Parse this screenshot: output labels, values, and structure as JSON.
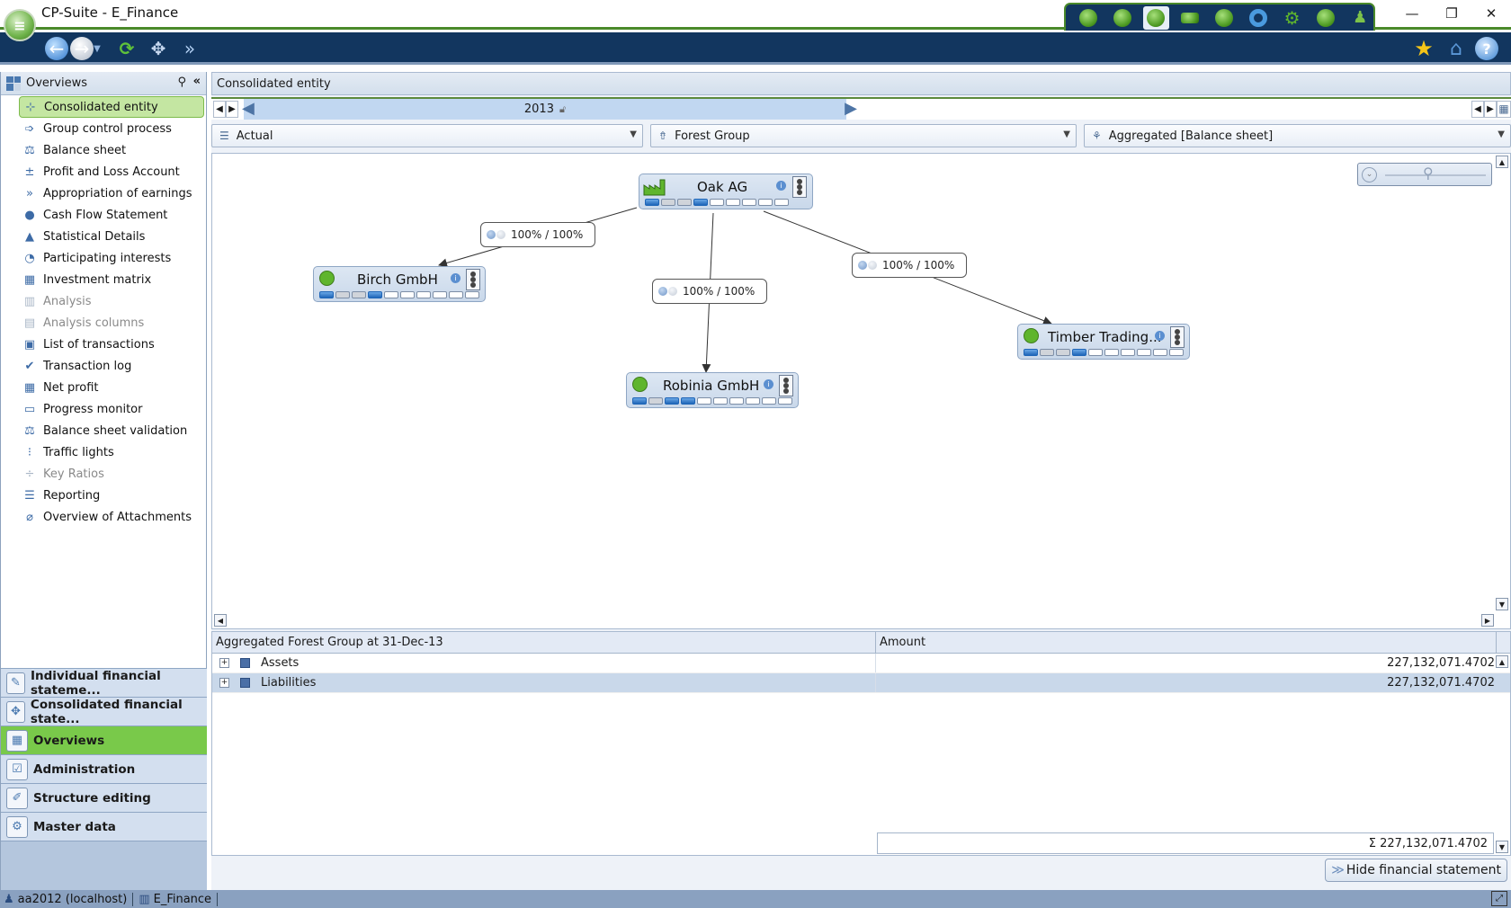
{
  "window": {
    "title": "CP-Suite - E_Finance",
    "controls": {
      "minimize": "—",
      "maximize": "❐",
      "close": "✕"
    }
  },
  "app_tabs": [
    {
      "name": "dashboard-icon"
    },
    {
      "name": "controlling-icon"
    },
    {
      "name": "finance-icon",
      "active": true
    },
    {
      "name": "money-icon"
    },
    {
      "name": "globe-icon"
    },
    {
      "name": "lifebuoy-icon"
    },
    {
      "name": "gears-icon"
    },
    {
      "name": "compass-icon"
    },
    {
      "name": "users-icon"
    }
  ],
  "toolbar": {
    "back": "back-icon",
    "forward": "forward-icon",
    "refresh": "refresh-icon",
    "structure": "structure-icon",
    "process": "process-icon",
    "favorites": "star-icon",
    "home": "home-icon",
    "help": "help-icon"
  },
  "left_panel": {
    "title": "Overviews",
    "items": [
      {
        "label": "Consolidated entity",
        "icon": "⊹",
        "selected": true
      },
      {
        "label": "Group control process",
        "icon": "➩"
      },
      {
        "label": "Balance sheet",
        "icon": "⚖"
      },
      {
        "label": "Profit and Loss Account",
        "icon": "±"
      },
      {
        "label": "Appropriation of earnings",
        "icon": "»"
      },
      {
        "label": "Cash Flow Statement",
        "icon": "●"
      },
      {
        "label": "Statistical Details",
        "icon": "▲"
      },
      {
        "label": "Participating interests",
        "icon": "◔"
      },
      {
        "label": "Investment matrix",
        "icon": "▦"
      },
      {
        "label": "Analysis",
        "icon": "▥",
        "disabled": true
      },
      {
        "label": "Analysis columns",
        "icon": "▤",
        "disabled": true
      },
      {
        "label": "List of transactions",
        "icon": "▣"
      },
      {
        "label": "Transaction log",
        "icon": "✔"
      },
      {
        "label": "Net profit",
        "icon": "▦"
      },
      {
        "label": "Progress monitor",
        "icon": "▭"
      },
      {
        "label": "Balance sheet validation",
        "icon": "⚖"
      },
      {
        "label": "Traffic lights",
        "icon": "⁝"
      },
      {
        "label": "Key Ratios",
        "icon": "÷",
        "disabled": true
      },
      {
        "label": "Reporting",
        "icon": "☰"
      },
      {
        "label": "Overview of Attachments",
        "icon": "⌀"
      }
    ],
    "modules": [
      {
        "label": "Individual financial stateme...",
        "icon": "✎"
      },
      {
        "label": "Consolidated financial state...",
        "icon": "✥"
      },
      {
        "label": "Overviews",
        "icon": "▦",
        "active": true
      },
      {
        "label": "Administration",
        "icon": "☑"
      },
      {
        "label": "Structure editing",
        "icon": "✐"
      },
      {
        "label": "Master data",
        "icon": "⚙"
      }
    ]
  },
  "main": {
    "header": "Consolidated entity",
    "period": "2013",
    "filters": {
      "version": "Actual",
      "group": "Forest Group",
      "view": "Aggregated [Balance sheet]"
    },
    "entities": [
      {
        "name": "Oak AG",
        "type": "parent",
        "status": [
          1,
          2,
          2,
          1,
          0,
          0,
          0,
          0,
          0
        ]
      },
      {
        "name": "Birch GmbH",
        "type": "subsidiary",
        "status": [
          1,
          2,
          2,
          1,
          0,
          0,
          0,
          0,
          0,
          0
        ]
      },
      {
        "name": "Robinia GmbH",
        "type": "subsidiary",
        "status": [
          1,
          2,
          1,
          1,
          0,
          0,
          0,
          0,
          0,
          0
        ]
      },
      {
        "name": "Timber Trading...",
        "type": "subsidiary",
        "status": [
          1,
          2,
          2,
          1,
          0,
          0,
          0,
          0,
          0,
          0
        ]
      }
    ],
    "edges": [
      {
        "from": "Oak AG",
        "to": "Birch GmbH",
        "label": "100% / 100%"
      },
      {
        "from": "Oak AG",
        "to": "Robinia GmbH",
        "label": "100% / 100%"
      },
      {
        "from": "Oak AG",
        "to": "Timber Trading...",
        "label": "100% / 100%"
      }
    ],
    "grid": {
      "columns": [
        "Aggregated Forest Group at 31-Dec-13",
        "Amount"
      ],
      "rows": [
        {
          "label": "Assets",
          "amount": "227,132,071.4702"
        },
        {
          "label": "Liabilities",
          "amount": "227,132,071.4702",
          "selected": true
        }
      ],
      "sum": "Σ 227,132,071.4702"
    },
    "hide_button": "Hide financial statement"
  },
  "statusbar": {
    "user": "aa2012 (localhost)",
    "database": "E_Finance"
  }
}
